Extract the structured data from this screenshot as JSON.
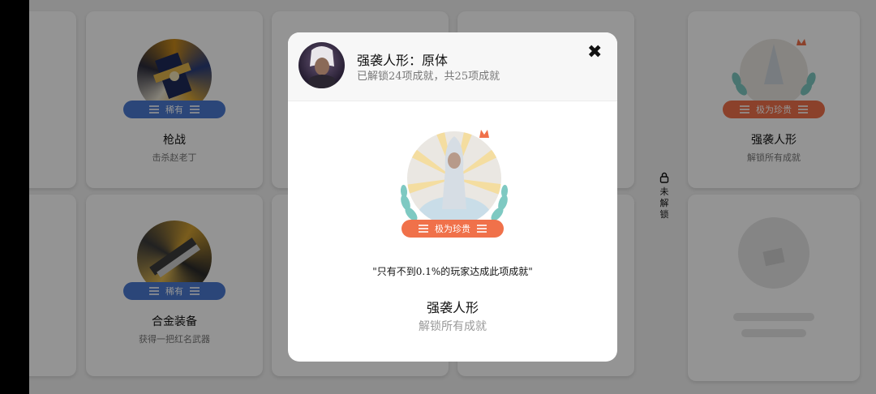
{
  "background": {
    "close_glyph": "✖",
    "cards": [
      {
        "title": "枪战",
        "desc": "击杀赵老丁",
        "rarity": "稀有"
      },
      {
        "title": "合金装备",
        "desc": "获得一把红名武器",
        "rarity": "稀有"
      },
      {
        "title": "强袭人形",
        "desc": "解锁所有成就",
        "rarity": "极为珍贵"
      }
    ],
    "lock_label": [
      "未",
      "解",
      "锁"
    ]
  },
  "modal": {
    "header_title": "强袭人形：原体",
    "header_subtitle": "已解锁24项成就，共25项成就",
    "close_glyph": "✖",
    "rarity": "极为珍贵",
    "quote": "\"只有不到0.1%的玩家达成此项成就\"",
    "achievement_name": "强袭人形",
    "achievement_desc": "解锁所有成就"
  },
  "icons": [
    "close-icon",
    "lock-icon",
    "crown-icon",
    "laurel-icon",
    "avatar"
  ],
  "colors": {
    "rare_blue": "#4a79d0",
    "legendary_orange": "#f0714a",
    "laurel_teal": "#7ec9c2",
    "crown_orange": "#f0714a"
  }
}
